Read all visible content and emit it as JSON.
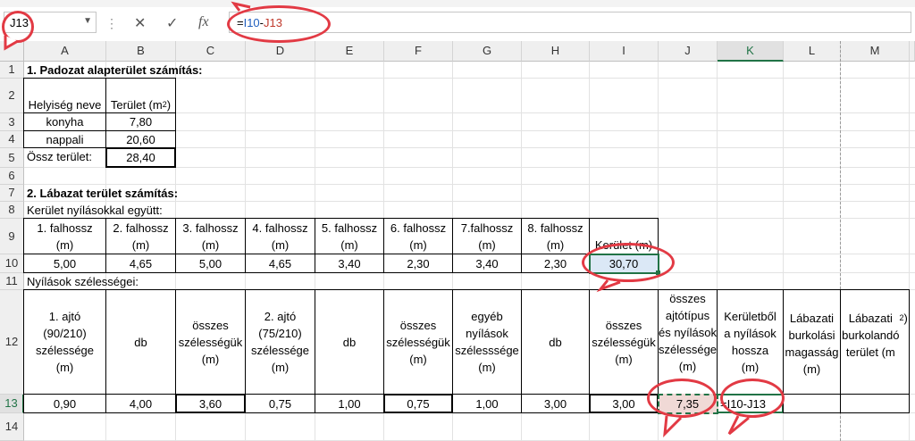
{
  "formula_bar": {
    "name_box": "J13",
    "fx_label": "fx",
    "formula_parts": [
      "=",
      "I10",
      "-",
      "J13"
    ]
  },
  "columns": [
    "A",
    "B",
    "C",
    "D",
    "E",
    "F",
    "G",
    "H",
    "I",
    "J",
    "K",
    "L",
    "M"
  ],
  "rows": [
    "1",
    "2",
    "3",
    "4",
    "5",
    "6",
    "7",
    "8",
    "9",
    "10",
    "11",
    "12",
    "13",
    "14"
  ],
  "section1": {
    "title": "1. Padozat alapterület számítás:",
    "hdr_room": "Helyiség neve",
    "hdr_area": "Terület (m",
    "hdr_area_sup": "2",
    "hdr_area_end": ")",
    "rooms": [
      {
        "name": "konyha",
        "area": "7,80"
      },
      {
        "name": "nappali",
        "area": "20,60"
      }
    ],
    "total_label": "Össz terület:",
    "total_value": "28,40"
  },
  "section2": {
    "title": "2. Lábazat terület számítás:",
    "perimeter_label": "Kerület nyílásokkal együtt:",
    "wall_headers": [
      "1. falhossz (m)",
      "2. falhossz (m)",
      "3. falhossz (m)",
      "4. falhossz (m)",
      "5. falhossz (m)",
      "6. falhossz (m)",
      "7.falhossz (m)",
      "8. falhossz (m)"
    ],
    "wall_values": [
      "5,00",
      "4,65",
      "5,00",
      "4,65",
      "3,40",
      "2,30",
      "3,40",
      "2,30"
    ],
    "perimeter_header": "Kerület (m)",
    "perimeter_value": "30,70",
    "openings_label": "Nyílások szélességei:",
    "opening_headers": [
      "1. ajtó (90/210) szélessége (m)",
      "db",
      "összes szélességük (m)",
      "2. ajtó (75/210) szélessége (m)",
      "db",
      "összes szélességük (m)",
      "egyéb nyílások szélesssége (m)",
      "db",
      "összes szélességük (m)",
      "összes ajtótípus és nyílások szélessége (m)",
      "Kerületből a nyílások hossza (m)",
      "Lábazati burkolási magasság (m)",
      "Lábazati burkolandó terület (m"
    ],
    "opening_header_last_sup": "2",
    "opening_header_last_end": ")",
    "opening_values": [
      "0,90",
      "4,00",
      "3,60",
      "0,75",
      "1,00",
      "0,75",
      "1,00",
      "3,00",
      "3,00",
      "7,35",
      "=I10-J13",
      "",
      ""
    ]
  }
}
